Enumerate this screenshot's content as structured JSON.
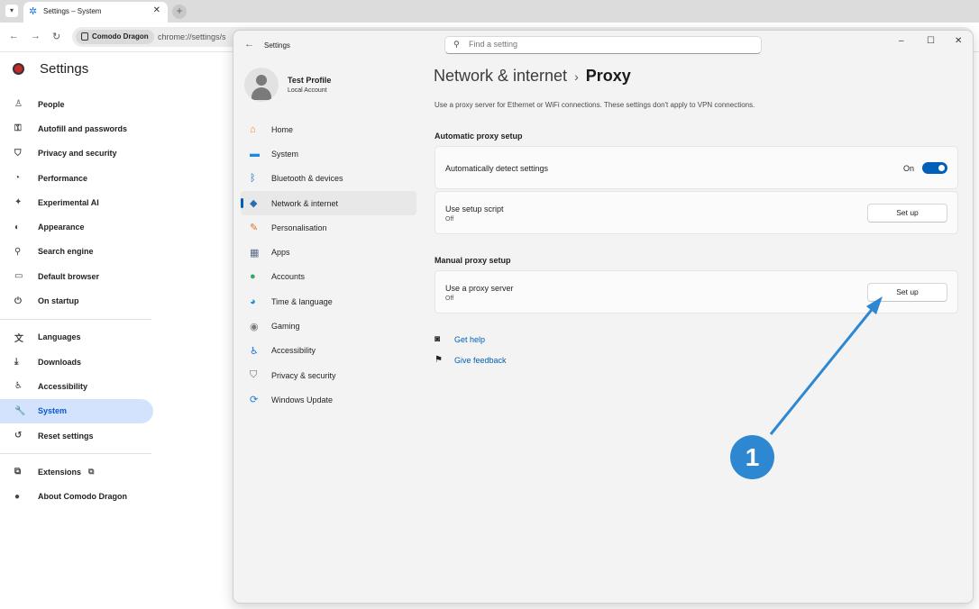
{
  "browser": {
    "tab_title": "Settings – System",
    "site_chip": "Comodo Dragon",
    "url": "chrome://settings/s"
  },
  "chrome_settings": {
    "title": "Settings",
    "items": [
      {
        "label": "People",
        "icon": "person-icon",
        "glyph": "♙"
      },
      {
        "label": "Autofill and passwords",
        "icon": "key-icon",
        "glyph": "⚿"
      },
      {
        "label": "Privacy and security",
        "icon": "shield-icon",
        "glyph": "⛉"
      },
      {
        "label": "Performance",
        "icon": "gauge-icon",
        "glyph": "◔"
      },
      {
        "label": "Experimental AI",
        "icon": "sparkle-icon",
        "glyph": "✦"
      },
      {
        "label": "Appearance",
        "icon": "palette-icon",
        "glyph": "◐"
      },
      {
        "label": "Search engine",
        "icon": "search-icon",
        "glyph": "⚲"
      },
      {
        "label": "Default browser",
        "icon": "browser-icon",
        "glyph": "▭"
      },
      {
        "label": "On startup",
        "icon": "power-icon",
        "glyph": "⏻"
      },
      {
        "label": "Languages",
        "icon": "translate-icon",
        "glyph": "文"
      },
      {
        "label": "Downloads",
        "icon": "download-icon",
        "glyph": "⤓"
      },
      {
        "label": "Accessibility",
        "icon": "accessibility-icon",
        "glyph": "♿"
      },
      {
        "label": "System",
        "icon": "wrench-icon",
        "glyph": "🔧"
      },
      {
        "label": "Reset settings",
        "icon": "reset-icon",
        "glyph": "↺"
      },
      {
        "label": "Extensions",
        "icon": "puzzle-icon",
        "glyph": "⧉"
      },
      {
        "label": "About Comodo Dragon",
        "icon": "dragon-logo-icon",
        "glyph": "●"
      }
    ]
  },
  "win_settings": {
    "app_title": "Settings",
    "search_placeholder": "Find a setting",
    "profile_name": "Test Profile",
    "profile_sub": "Local Account",
    "nav": [
      {
        "label": "Home",
        "icon": "home-icon",
        "glyph": "⌂",
        "color": "#e8833a"
      },
      {
        "label": "System",
        "icon": "monitor-icon",
        "glyph": "▬",
        "color": "#1e88e5"
      },
      {
        "label": "Bluetooth & devices",
        "icon": "bluetooth-icon",
        "glyph": "ᛒ",
        "color": "#1565c0"
      },
      {
        "label": "Network & internet",
        "icon": "wifi-icon",
        "glyph": "◆",
        "color": "#2b6cb0"
      },
      {
        "label": "Personalisation",
        "icon": "brush-icon",
        "glyph": "✎",
        "color": "#e07020"
      },
      {
        "label": "Apps",
        "icon": "apps-icon",
        "glyph": "▦",
        "color": "#5a6a8a"
      },
      {
        "label": "Accounts",
        "icon": "accounts-icon",
        "glyph": "●",
        "color": "#2eaa6f"
      },
      {
        "label": "Time & language",
        "icon": "globe-clock-icon",
        "glyph": "◕",
        "color": "#1c8ed6"
      },
      {
        "label": "Gaming",
        "icon": "gamepad-icon",
        "glyph": "◉",
        "color": "#7a7a7a"
      },
      {
        "label": "Accessibility",
        "icon": "accessibility-icon",
        "glyph": "♿",
        "color": "#1976d2"
      },
      {
        "label": "Privacy & security",
        "icon": "shield-icon",
        "glyph": "⛉",
        "color": "#6b6b6b"
      },
      {
        "label": "Windows Update",
        "icon": "update-icon",
        "glyph": "⟳",
        "color": "#1a7fd4"
      }
    ],
    "breadcrumb_parent": "Network & internet",
    "breadcrumb_sep": "›",
    "breadcrumb_current": "Proxy",
    "description": "Use a proxy server for Ethernet or WiFi connections. These settings don't apply to VPN connections.",
    "auto_section": "Automatic proxy setup",
    "auto_detect_label": "Automatically detect settings",
    "auto_detect_state": "On",
    "setup_script_label": "Use setup script",
    "setup_script_state": "Off",
    "setup_script_button": "Set up",
    "manual_section": "Manual proxy setup",
    "proxy_server_label": "Use a proxy server",
    "proxy_server_state": "Off",
    "proxy_server_button": "Set up",
    "get_help": "Get help",
    "give_feedback": "Give feedback"
  },
  "annotation": {
    "badge": "1",
    "color": "#2d88d1"
  }
}
